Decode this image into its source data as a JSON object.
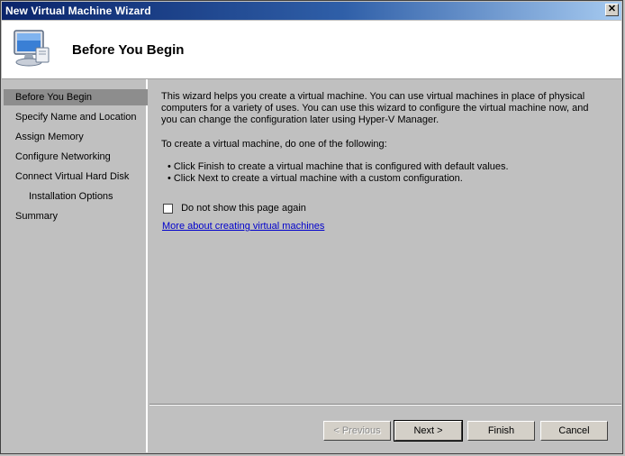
{
  "window": {
    "title": "New Virtual Machine Wizard",
    "close_glyph": "✕"
  },
  "header": {
    "title": "Before You Begin",
    "icon": "computer-monitor-icon"
  },
  "sidebar": {
    "items": [
      {
        "label": "Before You Begin",
        "active": true
      },
      {
        "label": "Specify Name and Location"
      },
      {
        "label": "Assign Memory"
      },
      {
        "label": "Configure Networking"
      },
      {
        "label": "Connect Virtual Hard Disk"
      },
      {
        "label": "Installation Options",
        "sub": true
      },
      {
        "label": "Summary"
      }
    ]
  },
  "content": {
    "intro_line1": "This wizard helps you create a virtual machine. You can use virtual machines in place of physical",
    "intro_line2": "computers for a variety of uses. You can use this wizard to configure the virtual machine now, and",
    "intro_line3": "you can change the configuration later using Hyper-V Manager.",
    "instruction": "To create a virtual machine, do one of the following:",
    "bullets": [
      "Click Finish to create a virtual machine that is configured with default values.",
      "Click Next to create a virtual machine with a custom configuration."
    ],
    "checkbox_label": "Do not show this page again",
    "checkbox_checked": false,
    "link_text": "More about creating virtual machines"
  },
  "buttons": {
    "previous": "< Previous",
    "next": "Next >",
    "finish": "Finish",
    "cancel": "Cancel"
  }
}
